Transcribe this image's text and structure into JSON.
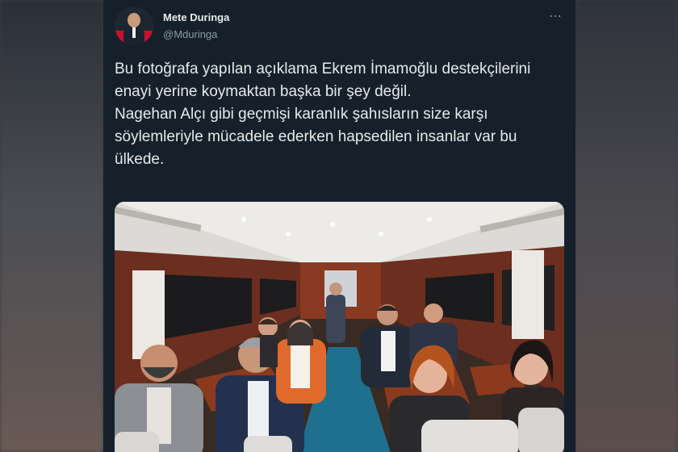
{
  "tweet": {
    "author_name": "Mete Duringa",
    "author_handle": "@Mduringa",
    "more_icon": "⋯",
    "text": "Bu fotoğrafa yapılan açıklama Ekrem İmamoğlu destekçilerini enayi yerine koymaktan başka bir şey değil.\nNagehan Alçı gibi geçmişi karanlık şahısların size karşı söylemleriyle mücadele ederken hapsedilen insanlar var bu ülkede."
  },
  "media": {
    "icon": "photo-bus-interior"
  },
  "colors": {
    "card_bg": "#15202b",
    "text": "#e7e9ea",
    "secondary": "#8b98a5",
    "aisle": "#1f6f8f"
  }
}
